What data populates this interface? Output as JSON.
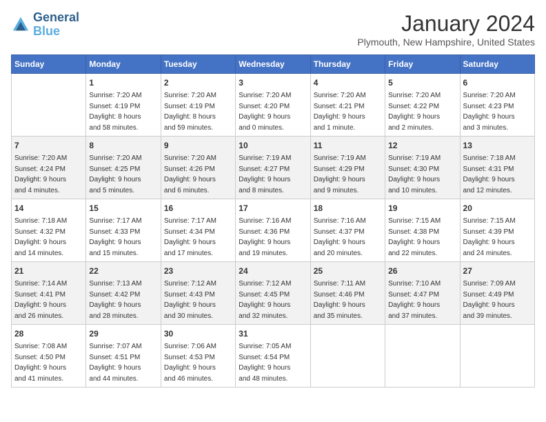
{
  "header": {
    "logo_line1": "General",
    "logo_line2": "Blue",
    "month": "January 2024",
    "location": "Plymouth, New Hampshire, United States"
  },
  "weekdays": [
    "Sunday",
    "Monday",
    "Tuesday",
    "Wednesday",
    "Thursday",
    "Friday",
    "Saturday"
  ],
  "weeks": [
    [
      {
        "day": "",
        "sunrise": "",
        "sunset": "",
        "daylight": ""
      },
      {
        "day": "1",
        "sunrise": "Sunrise: 7:20 AM",
        "sunset": "Sunset: 4:19 PM",
        "daylight": "Daylight: 8 hours and 58 minutes."
      },
      {
        "day": "2",
        "sunrise": "Sunrise: 7:20 AM",
        "sunset": "Sunset: 4:19 PM",
        "daylight": "Daylight: 8 hours and 59 minutes."
      },
      {
        "day": "3",
        "sunrise": "Sunrise: 7:20 AM",
        "sunset": "Sunset: 4:20 PM",
        "daylight": "Daylight: 9 hours and 0 minutes."
      },
      {
        "day": "4",
        "sunrise": "Sunrise: 7:20 AM",
        "sunset": "Sunset: 4:21 PM",
        "daylight": "Daylight: 9 hours and 1 minute."
      },
      {
        "day": "5",
        "sunrise": "Sunrise: 7:20 AM",
        "sunset": "Sunset: 4:22 PM",
        "daylight": "Daylight: 9 hours and 2 minutes."
      },
      {
        "day": "6",
        "sunrise": "Sunrise: 7:20 AM",
        "sunset": "Sunset: 4:23 PM",
        "daylight": "Daylight: 9 hours and 3 minutes."
      }
    ],
    [
      {
        "day": "7",
        "sunrise": "Sunrise: 7:20 AM",
        "sunset": "Sunset: 4:24 PM",
        "daylight": "Daylight: 9 hours and 4 minutes."
      },
      {
        "day": "8",
        "sunrise": "Sunrise: 7:20 AM",
        "sunset": "Sunset: 4:25 PM",
        "daylight": "Daylight: 9 hours and 5 minutes."
      },
      {
        "day": "9",
        "sunrise": "Sunrise: 7:20 AM",
        "sunset": "Sunset: 4:26 PM",
        "daylight": "Daylight: 9 hours and 6 minutes."
      },
      {
        "day": "10",
        "sunrise": "Sunrise: 7:19 AM",
        "sunset": "Sunset: 4:27 PM",
        "daylight": "Daylight: 9 hours and 8 minutes."
      },
      {
        "day": "11",
        "sunrise": "Sunrise: 7:19 AM",
        "sunset": "Sunset: 4:29 PM",
        "daylight": "Daylight: 9 hours and 9 minutes."
      },
      {
        "day": "12",
        "sunrise": "Sunrise: 7:19 AM",
        "sunset": "Sunset: 4:30 PM",
        "daylight": "Daylight: 9 hours and 10 minutes."
      },
      {
        "day": "13",
        "sunrise": "Sunrise: 7:18 AM",
        "sunset": "Sunset: 4:31 PM",
        "daylight": "Daylight: 9 hours and 12 minutes."
      }
    ],
    [
      {
        "day": "14",
        "sunrise": "Sunrise: 7:18 AM",
        "sunset": "Sunset: 4:32 PM",
        "daylight": "Daylight: 9 hours and 14 minutes."
      },
      {
        "day": "15",
        "sunrise": "Sunrise: 7:17 AM",
        "sunset": "Sunset: 4:33 PM",
        "daylight": "Daylight: 9 hours and 15 minutes."
      },
      {
        "day": "16",
        "sunrise": "Sunrise: 7:17 AM",
        "sunset": "Sunset: 4:34 PM",
        "daylight": "Daylight: 9 hours and 17 minutes."
      },
      {
        "day": "17",
        "sunrise": "Sunrise: 7:16 AM",
        "sunset": "Sunset: 4:36 PM",
        "daylight": "Daylight: 9 hours and 19 minutes."
      },
      {
        "day": "18",
        "sunrise": "Sunrise: 7:16 AM",
        "sunset": "Sunset: 4:37 PM",
        "daylight": "Daylight: 9 hours and 20 minutes."
      },
      {
        "day": "19",
        "sunrise": "Sunrise: 7:15 AM",
        "sunset": "Sunset: 4:38 PM",
        "daylight": "Daylight: 9 hours and 22 minutes."
      },
      {
        "day": "20",
        "sunrise": "Sunrise: 7:15 AM",
        "sunset": "Sunset: 4:39 PM",
        "daylight": "Daylight: 9 hours and 24 minutes."
      }
    ],
    [
      {
        "day": "21",
        "sunrise": "Sunrise: 7:14 AM",
        "sunset": "Sunset: 4:41 PM",
        "daylight": "Daylight: 9 hours and 26 minutes."
      },
      {
        "day": "22",
        "sunrise": "Sunrise: 7:13 AM",
        "sunset": "Sunset: 4:42 PM",
        "daylight": "Daylight: 9 hours and 28 minutes."
      },
      {
        "day": "23",
        "sunrise": "Sunrise: 7:12 AM",
        "sunset": "Sunset: 4:43 PM",
        "daylight": "Daylight: 9 hours and 30 minutes."
      },
      {
        "day": "24",
        "sunrise": "Sunrise: 7:12 AM",
        "sunset": "Sunset: 4:45 PM",
        "daylight": "Daylight: 9 hours and 32 minutes."
      },
      {
        "day": "25",
        "sunrise": "Sunrise: 7:11 AM",
        "sunset": "Sunset: 4:46 PM",
        "daylight": "Daylight: 9 hours and 35 minutes."
      },
      {
        "day": "26",
        "sunrise": "Sunrise: 7:10 AM",
        "sunset": "Sunset: 4:47 PM",
        "daylight": "Daylight: 9 hours and 37 minutes."
      },
      {
        "day": "27",
        "sunrise": "Sunrise: 7:09 AM",
        "sunset": "Sunset: 4:49 PM",
        "daylight": "Daylight: 9 hours and 39 minutes."
      }
    ],
    [
      {
        "day": "28",
        "sunrise": "Sunrise: 7:08 AM",
        "sunset": "Sunset: 4:50 PM",
        "daylight": "Daylight: 9 hours and 41 minutes."
      },
      {
        "day": "29",
        "sunrise": "Sunrise: 7:07 AM",
        "sunset": "Sunset: 4:51 PM",
        "daylight": "Daylight: 9 hours and 44 minutes."
      },
      {
        "day": "30",
        "sunrise": "Sunrise: 7:06 AM",
        "sunset": "Sunset: 4:53 PM",
        "daylight": "Daylight: 9 hours and 46 minutes."
      },
      {
        "day": "31",
        "sunrise": "Sunrise: 7:05 AM",
        "sunset": "Sunset: 4:54 PM",
        "daylight": "Daylight: 9 hours and 48 minutes."
      },
      {
        "day": "",
        "sunrise": "",
        "sunset": "",
        "daylight": ""
      },
      {
        "day": "",
        "sunrise": "",
        "sunset": "",
        "daylight": ""
      },
      {
        "day": "",
        "sunrise": "",
        "sunset": "",
        "daylight": ""
      }
    ]
  ]
}
